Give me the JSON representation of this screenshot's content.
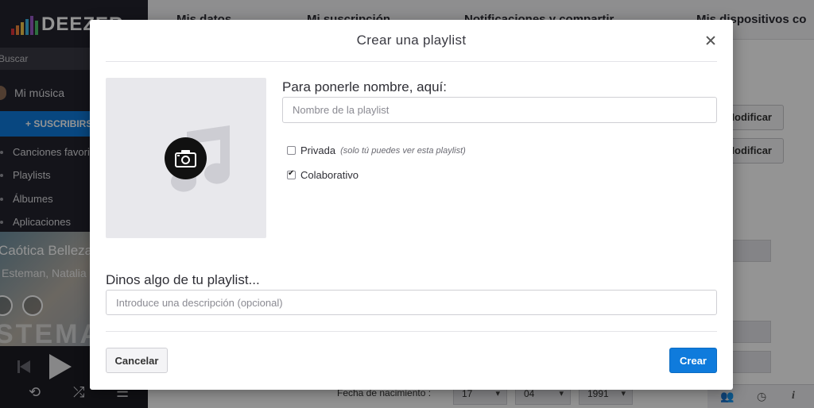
{
  "app": {
    "logo_text": "DEEZER",
    "search_placeholder": "Buscar",
    "my_music": "Mi música",
    "subscribe_label": "+ SUSCRIBIRSE",
    "nav": [
      "Canciones favoritas",
      "Playlists",
      "Álbumes",
      "Aplicaciones"
    ],
    "track_title": "Caótica Belleza",
    "track_artist": "Esteman, Natalia",
    "album_art_text": "STEMAN",
    "colors": {
      "sidebar": "#23232d",
      "accent": "#0f7bdc"
    }
  },
  "topnav": {
    "tabs": [
      "Mis datos",
      "Mi suscripción",
      "Notificaciones y compartir",
      "Mis dispositivos co"
    ]
  },
  "settings_bg": {
    "modify_label": "Modificar",
    "birthdate_label": "Fecha de nacimiento :",
    "birth_day": "17",
    "birth_month": "04",
    "birth_year": "1991"
  },
  "modal": {
    "title": "Crear una playlist",
    "close_icon": "close-icon",
    "cover_icons": [
      "music-note-icon",
      "camera-icon"
    ],
    "name_label": "Para ponerle nombre, aquí:",
    "name_placeholder": "Nombre de la playlist",
    "private_label": "Privada",
    "private_hint": "(solo tú puedes ver esta playlist)",
    "private_checked": false,
    "collaborative_label": "Colaborativo",
    "collaborative_checked": true,
    "description_label": "Dinos algo de tu playlist...",
    "description_placeholder": "Introduce una descripción (opcional)",
    "cancel_label": "Cancelar",
    "create_label": "Crear"
  }
}
